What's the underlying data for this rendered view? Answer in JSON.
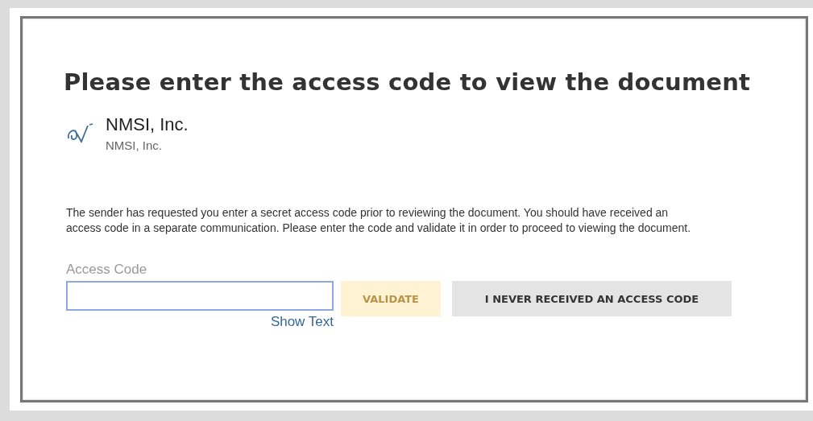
{
  "dialog": {
    "title": "Please enter the access code to view the document",
    "sender": {
      "name": "NMSI, Inc.",
      "subtitle": "NMSI, Inc."
    },
    "message": "The sender has requested you enter a secret access code prior to reviewing the document. You should have received an access code in a separate communication. Please enter the code and validate it in order to proceed to viewing the document.",
    "access_code": {
      "label": "Access Code",
      "focused": true,
      "show_text_link": "Show Text"
    },
    "buttons": [
      {
        "label": "VALIDATE",
        "kind": "primary",
        "disabled": true
      },
      {
        "label": "I NEVER RECEIVED AN ACCESS CODE",
        "kind": "secondary",
        "disabled": false
      }
    ]
  }
}
